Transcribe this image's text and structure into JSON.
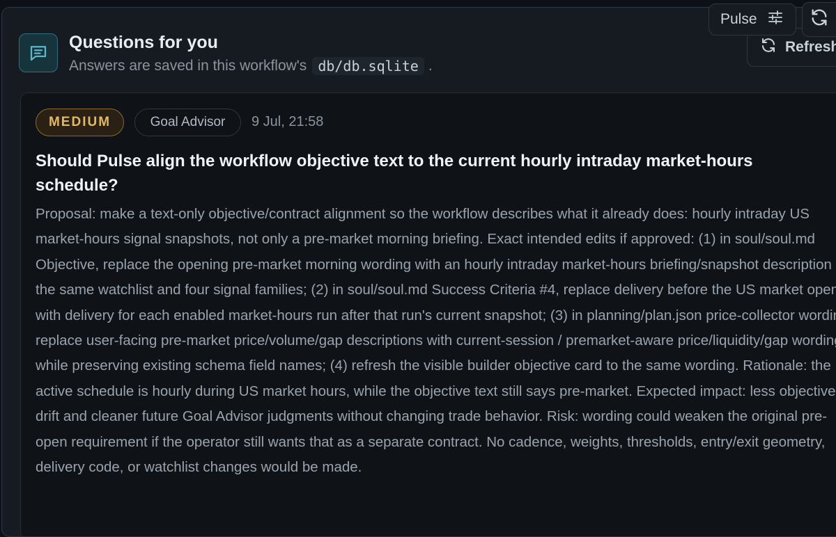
{
  "header": {
    "title": "Questions for you",
    "subtitle_prefix": "Answers are saved in this workflow's",
    "subtitle_code": "db/db.sqlite",
    "subtitle_suffix": "."
  },
  "toolbar": {
    "pulse_label": "Pulse",
    "refresh_label": "Refresh"
  },
  "question": {
    "priority": "MEDIUM",
    "source": "Goal Advisor",
    "timestamp": "9 Jul, 21:58",
    "title": "Should Pulse align the workflow objective text to the current hourly intraday market-hours schedule?",
    "body": "Proposal: make a text-only objective/contract alignment so the workflow describes what it already does: hourly intraday US market-hours signal snapshots, not only a pre-market morning briefing. Exact intended edits if approved: (1) in soul/soul.md Objective, replace the opening pre-market morning wording with an hourly intraday market-hours briefing/snapshot description for the same watchlist and four signal families; (2) in soul/soul.md Success Criteria #4, replace delivery before the US market open with delivery for each enabled market-hours run after that run's current snapshot; (3) in planning/plan.json price-collector wording, replace user-facing pre-market price/volume/gap descriptions with current-session / premarket-aware price/liquidity/gap wording while preserving existing schema field names; (4) refresh the visible builder objective card to the same wording. Rationale: the active schedule is hourly during US market hours, while the objective text still says pre-market. Expected impact: less objective drift and cleaner future Goal Advisor judgments without changing trade behavior. Risk: wording could weaken the original pre-open requirement if the operator still wants that as a separate contract. No cadence, weights, thresholds, entry/exit geometry, delivery code, or watchlist changes would be made."
  },
  "colors": {
    "accent_teal": "#2f6f80",
    "priority_medium": "#e3b868"
  },
  "icons": {
    "header": "message-square-text-icon",
    "pulse": "sliders-icon",
    "refresh": "refresh-icon"
  }
}
